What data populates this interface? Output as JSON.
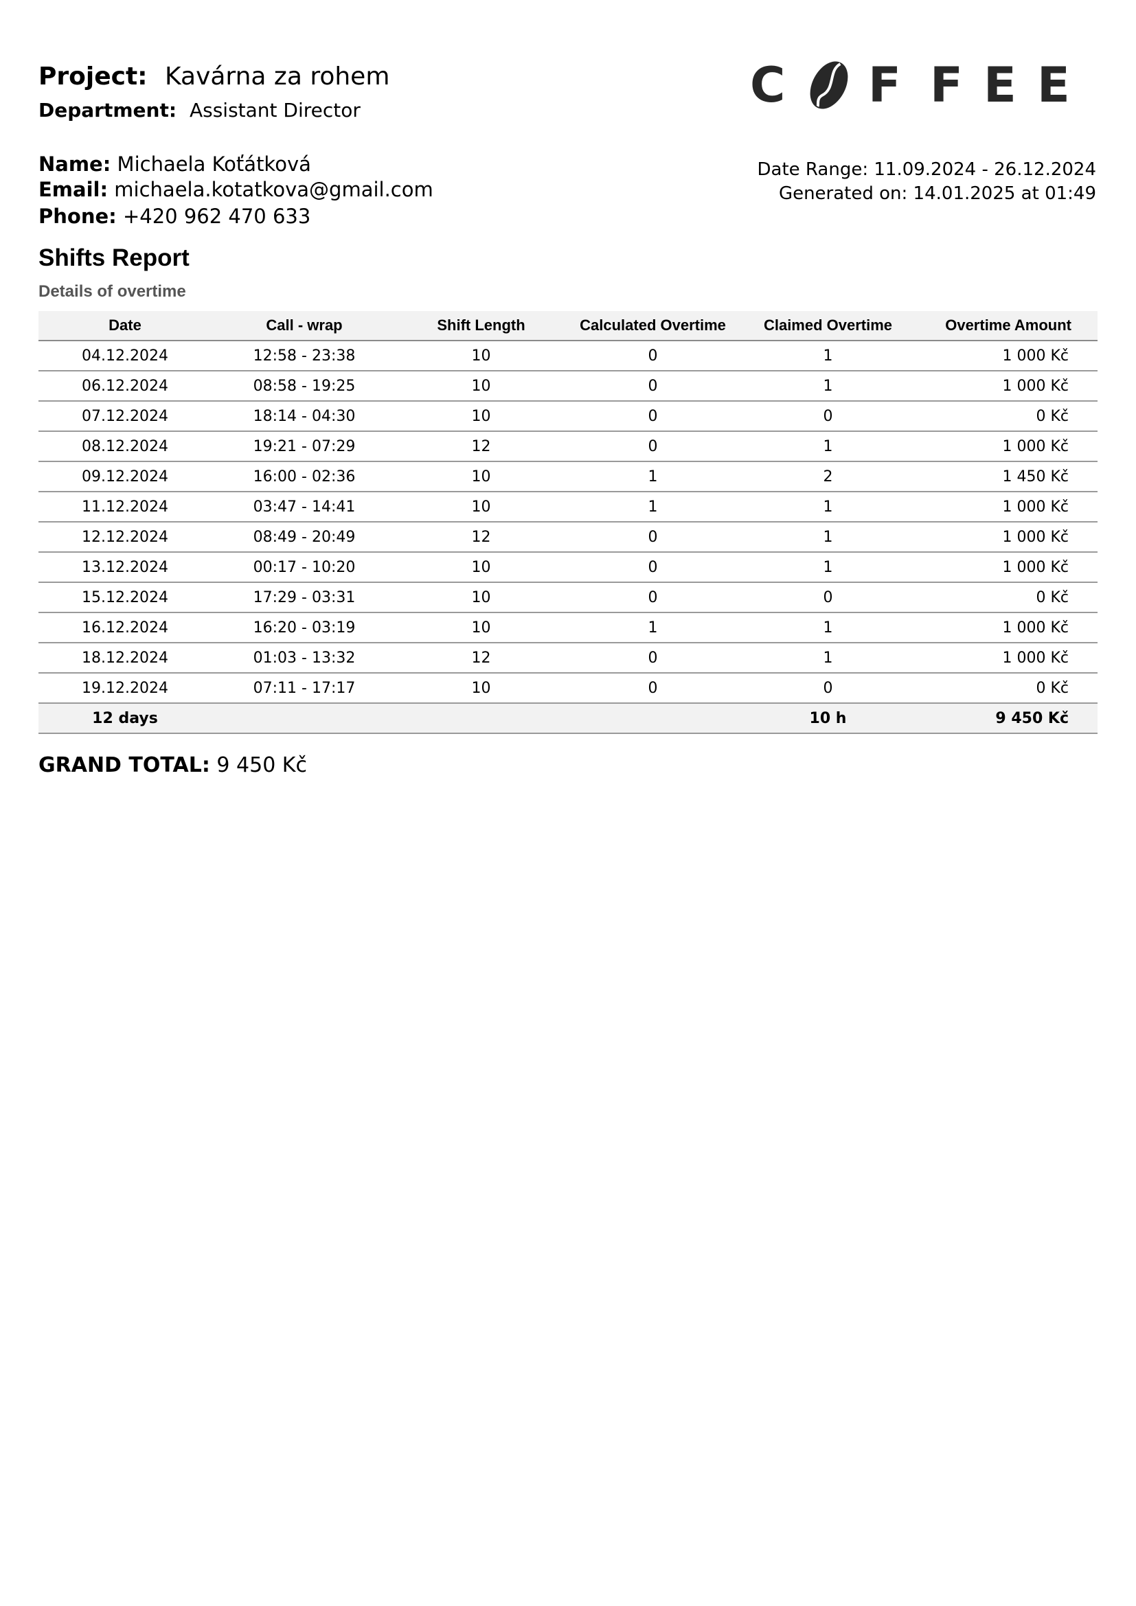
{
  "header": {
    "project_label": "Project:",
    "project_value": "Kavárna za rohem",
    "department_label": "Department:",
    "department_value": "Assistant Director"
  },
  "contact": {
    "name_label": "Name:",
    "name_value": "Michaela Koťátková",
    "email_label": "Email:",
    "email_value": "michaela.kotatkova@gmail.com",
    "phone_label": "Phone:",
    "phone_value": "+420 962 470 633"
  },
  "logo": {
    "letters": [
      "C",
      "F",
      "F",
      "E",
      "E"
    ],
    "text": "COFFEE",
    "icon": "coffee-bean-icon",
    "color": "#282828"
  },
  "meta": {
    "date_range": "Date Range: 11.09.2024 - 26.12.2024",
    "generated": "Generated on: 14.01.2025 at 01:49"
  },
  "report": {
    "title": "Shifts Report",
    "subtitle": "Details of overtime"
  },
  "table": {
    "columns": [
      "Date",
      "Call - wrap",
      "Shift Length",
      "Calculated Overtime",
      "Claimed Overtime",
      "Overtime Amount"
    ],
    "rows": [
      {
        "date": "04.12.2024",
        "call_wrap": "12:58 - 23:38",
        "shift_length": "10",
        "calculated": "0",
        "claimed": "1",
        "amount": "1 000 Kč"
      },
      {
        "date": "06.12.2024",
        "call_wrap": "08:58 - 19:25",
        "shift_length": "10",
        "calculated": "0",
        "claimed": "1",
        "amount": "1 000 Kč"
      },
      {
        "date": "07.12.2024",
        "call_wrap": "18:14 - 04:30",
        "shift_length": "10",
        "calculated": "0",
        "claimed": "0",
        "amount": "0 Kč"
      },
      {
        "date": "08.12.2024",
        "call_wrap": "19:21 - 07:29",
        "shift_length": "12",
        "calculated": "0",
        "claimed": "1",
        "amount": "1 000 Kč"
      },
      {
        "date": "09.12.2024",
        "call_wrap": "16:00 - 02:36",
        "shift_length": "10",
        "calculated": "1",
        "claimed": "2",
        "amount": "1 450 Kč"
      },
      {
        "date": "11.12.2024",
        "call_wrap": "03:47 - 14:41",
        "shift_length": "10",
        "calculated": "1",
        "claimed": "1",
        "amount": "1 000 Kč"
      },
      {
        "date": "12.12.2024",
        "call_wrap": "08:49 - 20:49",
        "shift_length": "12",
        "calculated": "0",
        "claimed": "1",
        "amount": "1 000 Kč"
      },
      {
        "date": "13.12.2024",
        "call_wrap": "00:17 - 10:20",
        "shift_length": "10",
        "calculated": "0",
        "claimed": "1",
        "amount": "1 000 Kč"
      },
      {
        "date": "15.12.2024",
        "call_wrap": "17:29 - 03:31",
        "shift_length": "10",
        "calculated": "0",
        "claimed": "0",
        "amount": "0 Kč"
      },
      {
        "date": "16.12.2024",
        "call_wrap": "16:20 - 03:19",
        "shift_length": "10",
        "calculated": "1",
        "claimed": "1",
        "amount": "1 000 Kč"
      },
      {
        "date": "18.12.2024",
        "call_wrap": "01:03 - 13:32",
        "shift_length": "12",
        "calculated": "0",
        "claimed": "1",
        "amount": "1 000 Kč"
      },
      {
        "date": "19.12.2024",
        "call_wrap": "07:11 - 17:17",
        "shift_length": "10",
        "calculated": "0",
        "claimed": "0",
        "amount": "0 Kč"
      }
    ],
    "total": {
      "days": "12 days",
      "claimed": "10 h",
      "amount": "9 450 Kč"
    },
    "header_bg": "#f2f2f2"
  },
  "grand_total": {
    "label": "GRAND TOTAL:",
    "value": "9 450 Kč"
  }
}
